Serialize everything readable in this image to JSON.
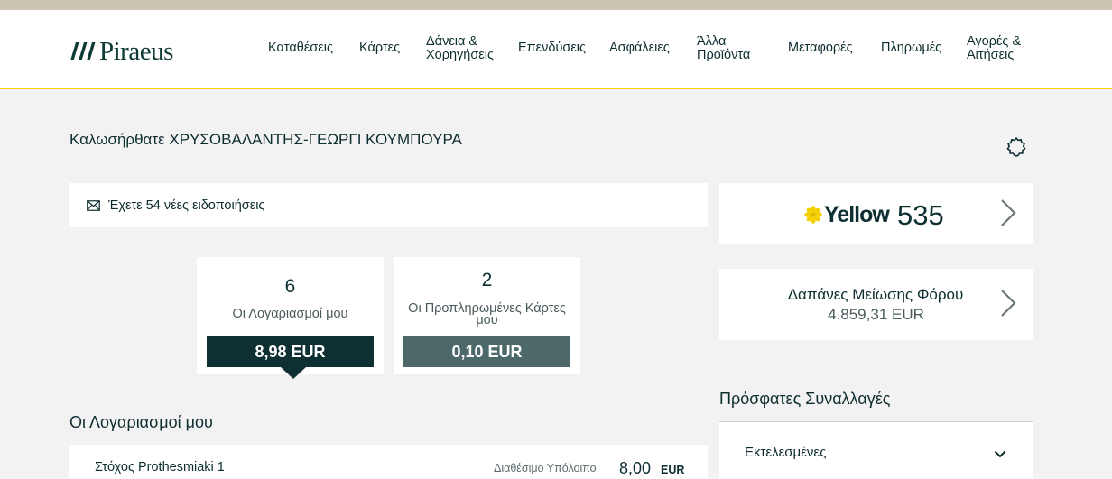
{
  "brand": {
    "name": "Piraeus",
    "accent": "#f5d000",
    "dark": "#0e3033",
    "muted": "#4d6868"
  },
  "nav": {
    "items": [
      {
        "l1": "Καταθέσεις",
        "l2": ""
      },
      {
        "l1": "Κάρτες",
        "l2": ""
      },
      {
        "l1": "Δάνεια &",
        "l2": "Χορηγήσεις"
      },
      {
        "l1": "Επενδύσεις",
        "l2": ""
      },
      {
        "l1": "Ασφάλειες",
        "l2": ""
      },
      {
        "l1": "Άλλα",
        "l2": "Προϊόντα"
      },
      {
        "l1": "Μεταφορές",
        "l2": ""
      },
      {
        "l1": "Πληρωμές",
        "l2": ""
      },
      {
        "l1": "Αγορές &",
        "l2": "Αιτήσεις"
      }
    ]
  },
  "welcome": "Καλωσήρθατε ΧΡΥΣΟΒΑΛΑΝΤΗΣ-ΓΕΩΡΓΙ ΚΟΥΜΠΟΥΡΑ",
  "settings_icon": "gear-icon",
  "notifications": {
    "icon": "envelope-icon",
    "text": "Έχετε 54 νέες ειδοποιήσεις"
  },
  "summary": {
    "accounts": {
      "count": "6",
      "label": "Οι Λογαριασμοί μου",
      "amount": "8,98 EUR",
      "selected": true
    },
    "prepaid": {
      "count": "2",
      "label_l1": "Οι Προπληρωμένες Κάρτες",
      "label_l2": "μου",
      "amount": "0,10 EUR",
      "selected": false
    }
  },
  "accounts_section": {
    "title": "Οι Λογαριασμοί μου",
    "rows": [
      {
        "name": "Στόχος Prothesmiaki 1",
        "available_label": "Διαθέσιμο Υπόλοιπο",
        "value": "8,00",
        "currency": "EUR"
      }
    ]
  },
  "yellow": {
    "brand": "Yellow",
    "points": "535"
  },
  "tax": {
    "label": "Δαπάνες Μείωσης Φόρου",
    "value": "4.859,31 EUR"
  },
  "recent": {
    "title": "Πρόσφατες Συναλλαγές",
    "filter": "Εκτελεσμένες"
  }
}
